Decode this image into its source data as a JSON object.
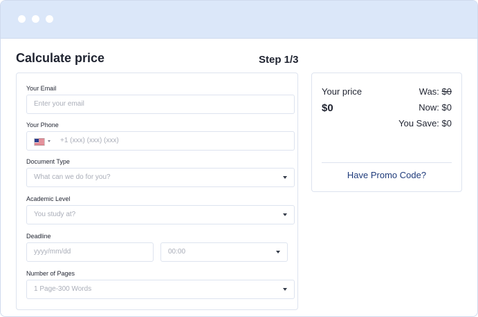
{
  "window": {
    "dots": [
      "",
      "",
      ""
    ]
  },
  "header": {
    "title": "Calculate price",
    "step": "Step 1/3"
  },
  "form": {
    "email": {
      "label": "Your Email",
      "placeholder": "Enter your email"
    },
    "phone": {
      "label": "Your Phone",
      "placeholder": "+1 (xxx) (xxx) (xxx)",
      "flag_icon": "us-flag-icon"
    },
    "document_type": {
      "label": "Document Type",
      "placeholder": "What can we do for you?"
    },
    "academic_level": {
      "label": "Academic Level",
      "placeholder": "You study at?"
    },
    "deadline": {
      "label": "Deadline",
      "date_placeholder": "yyyy/mm/dd",
      "time_value": "00:00"
    },
    "pages": {
      "label": "Number of Pages",
      "value": "1 Page-300 Words"
    }
  },
  "price": {
    "your_price_label": "Your price",
    "amount": "$0",
    "was_label": "Was: ",
    "was_value": "$0",
    "now": "Now: $0",
    "save": "You Save: $0",
    "promo": "Have Promo Code?"
  },
  "colors": {
    "titlebar": "#dbe7f9",
    "promo_link": "#1e3a7a",
    "border": "#dde3ef"
  }
}
